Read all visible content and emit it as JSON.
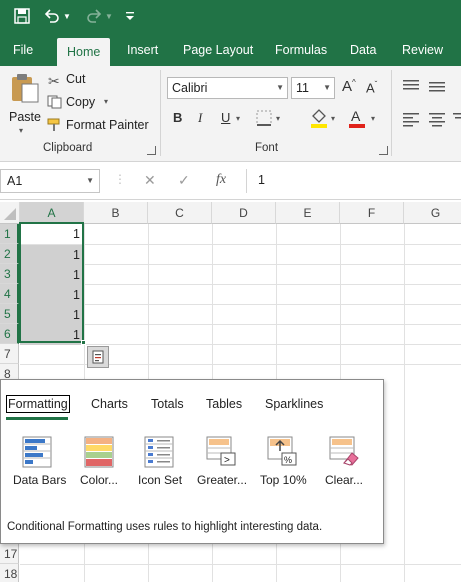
{
  "qat": {
    "icons": [
      "save-icon",
      "undo-icon",
      "undo-dropdown-icon",
      "redo-icon",
      "redo-dropdown-icon",
      "customize-qat-icon"
    ]
  },
  "tabs": [
    "File",
    "Home",
    "Insert",
    "Page Layout",
    "Formulas",
    "Data",
    "Review"
  ],
  "active_tab": "Home",
  "clipboard": {
    "paste": "Paste",
    "cut": "Cut",
    "copy": "Copy",
    "format_painter": "Format Painter",
    "group_label": "Clipboard"
  },
  "font": {
    "name": "Calibri",
    "size": "11",
    "bold": "B",
    "italic": "I",
    "underline": "U",
    "group_label": "Font",
    "highlight_color": "#ffe600",
    "font_color": "#e0221a"
  },
  "formula_bar": {
    "name_box": "A1",
    "fx": "fx",
    "value": "1"
  },
  "grid": {
    "columns": [
      "A",
      "B",
      "C",
      "D",
      "E",
      "F",
      "G"
    ],
    "rows": [
      "1",
      "2",
      "3",
      "4",
      "5",
      "6",
      "7",
      "8",
      "17",
      "18"
    ],
    "cell_values": [
      "1",
      "1",
      "1",
      "1",
      "1",
      "1"
    ]
  },
  "quick_analysis": {
    "tabs": [
      "Formatting",
      "Charts",
      "Totals",
      "Tables",
      "Sparklines"
    ],
    "active_tab": "Formatting",
    "options": [
      "Data Bars",
      "Color...",
      "Icon Set",
      "Greater...",
      "Top 10%",
      "Clear..."
    ],
    "description": "Conditional Formatting uses rules to highlight interesting data."
  },
  "colors": {
    "accent": "#217346",
    "selection": "#d0d0d0"
  }
}
